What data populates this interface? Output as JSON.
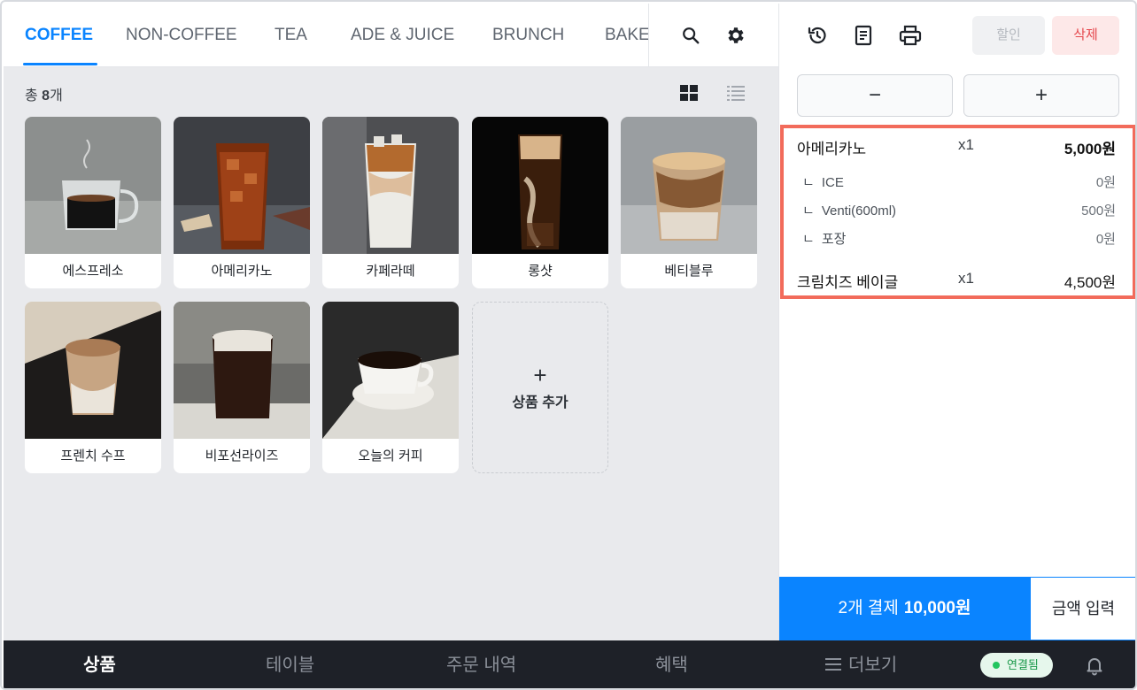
{
  "categories": {
    "tabs": [
      {
        "label": "COFFEE",
        "active": true
      },
      {
        "label": "NON-COFFEE",
        "active": false
      },
      {
        "label": "TEA",
        "active": false
      },
      {
        "label": "ADE & JUICE",
        "active": false
      },
      {
        "label": "BRUNCH",
        "active": false
      },
      {
        "label": "BAKERY",
        "active": false
      }
    ],
    "icons": [
      "search-icon",
      "gear-icon"
    ]
  },
  "products": {
    "count_prefix": "총 ",
    "count_value": "8",
    "count_suffix": "개",
    "view_modes": [
      "grid-view-icon",
      "list-view-icon"
    ],
    "items": [
      {
        "name": "에스프레소"
      },
      {
        "name": "아메리카노"
      },
      {
        "name": "카페라떼"
      },
      {
        "name": "롱샷"
      },
      {
        "name": "베티블루"
      },
      {
        "name": "프렌치 수프"
      },
      {
        "name": "비포선라이즈"
      },
      {
        "name": "오늘의 커피"
      }
    ],
    "add_label": "상품 추가",
    "add_symbol": "+"
  },
  "order": {
    "toolbar_icons": [
      "history-icon",
      "receipt-icon",
      "printer-icon"
    ],
    "discount_label": "할인",
    "delete_label": "삭제",
    "minus_label": "−",
    "plus_label": "+",
    "lines": [
      {
        "name": "아메리카노",
        "qty": "x1",
        "price": "5,000원",
        "options": [
          {
            "name": "ICE",
            "price": "0원"
          },
          {
            "name": "Venti(600ml)",
            "price": "500원"
          },
          {
            "name": "포장",
            "price": "0원"
          }
        ]
      },
      {
        "name": "크림치즈 베이글",
        "qty": "x1",
        "price": "4,500원",
        "options": []
      }
    ],
    "option_prefix": "ㄴ",
    "pay_label": "2개 결제",
    "pay_total": "10,000원",
    "amount_input_label": "금액 입력"
  },
  "bottom_nav": {
    "items": [
      {
        "label": "상품",
        "active": true
      },
      {
        "label": "테이블",
        "active": false
      },
      {
        "label": "주문 내역",
        "active": false
      },
      {
        "label": "혜택",
        "active": false
      },
      {
        "label": "더보기",
        "active": false
      }
    ],
    "connection_label": "연결됨",
    "colors": {
      "accent": "#0a84ff",
      "delete": "#e5484d",
      "connected": "#22c55e",
      "highlight": "#f26b5b"
    }
  }
}
